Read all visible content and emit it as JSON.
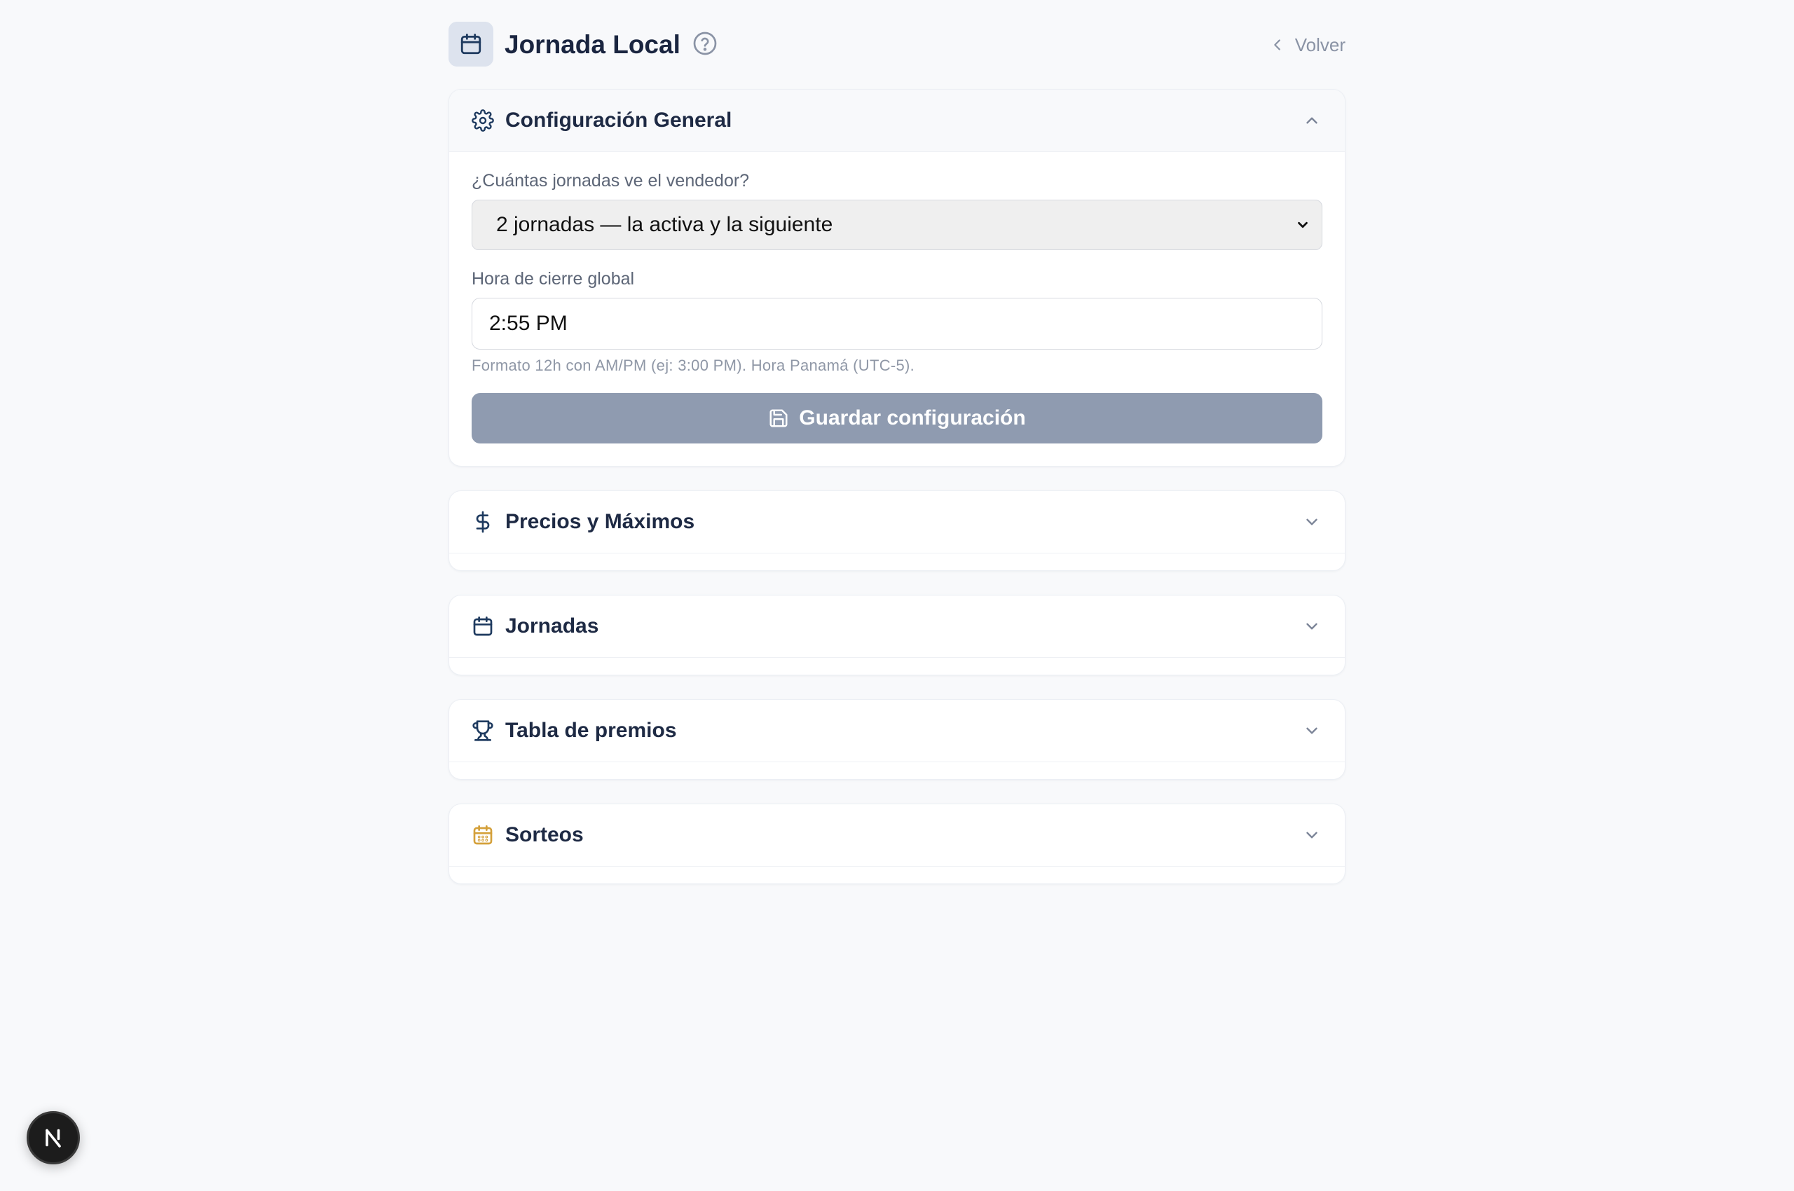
{
  "header": {
    "title": "Jornada Local",
    "back_label": "Volver"
  },
  "general": {
    "title": "Configuración General",
    "viewer_label": "¿Cuántas jornadas ve el vendedor?",
    "viewer_selected": "2 jornadas — la activa y la siguiente",
    "closing_label": "Hora de cierre global",
    "closing_value": "2:55 PM",
    "closing_hint": "Formato 12h con AM/PM (ej: 3:00 PM). Hora Panamá (UTC-5).",
    "save_label": "Guardar configuración"
  },
  "sections": {
    "prices": "Precios y Máximos",
    "days": "Jornadas",
    "prizes": "Tabla de premios",
    "draws": "Sorteos"
  },
  "colors": {
    "accent": "#1e3a5f",
    "draws_icon": "#d4a03a",
    "save_button_disabled": "#8f9bb0"
  }
}
